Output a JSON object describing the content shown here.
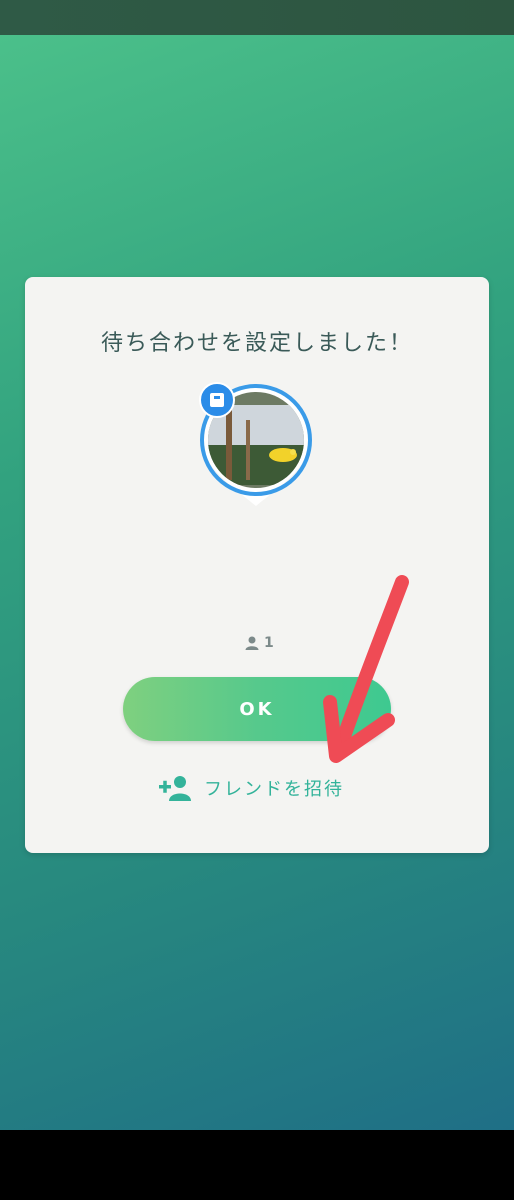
{
  "dialog": {
    "title": "待ち合わせを設定しました！",
    "player_count": "1",
    "ok_label": "OK",
    "invite_label": "フレンドを招待"
  },
  "colors": {
    "background_top": "#4bc08a",
    "background_bottom": "#1f6f86",
    "accent_green": "#33b39a",
    "annotation_arrow": "#ef4b55",
    "pin_ring": "#3a9be8"
  },
  "icons": {
    "badge": "gym-badge-icon",
    "player": "person-icon",
    "invite": "add-friend-icon",
    "arrow": "hand-drawn-arrow"
  }
}
